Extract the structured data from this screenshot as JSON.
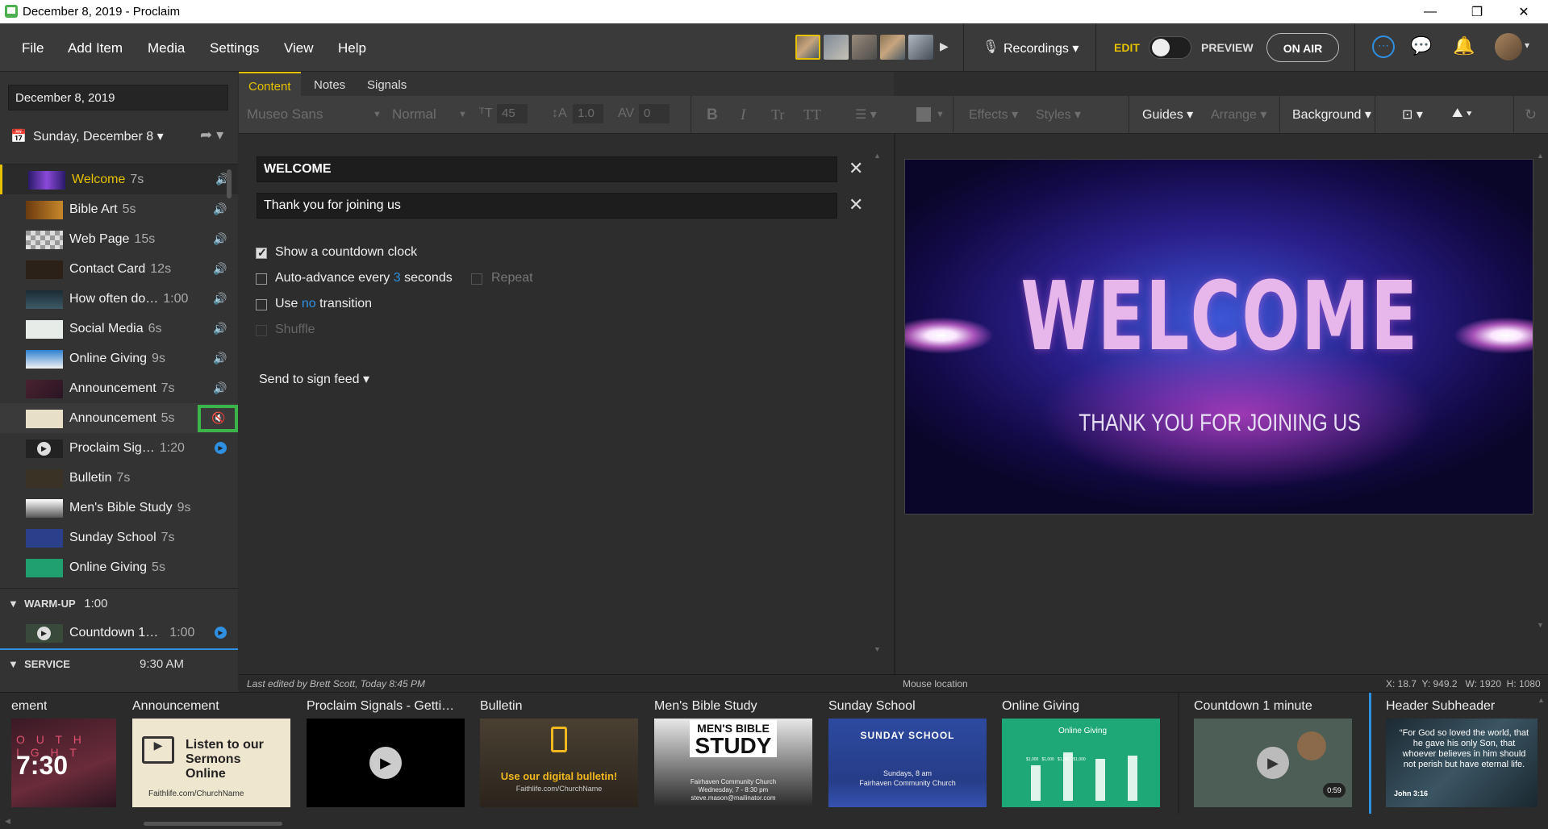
{
  "window": {
    "title": "December 8, 2019 - Proclaim",
    "controls": [
      "—",
      "❐",
      "✕"
    ]
  },
  "menu": [
    "File",
    "Add Item",
    "Media",
    "Settings",
    "View",
    "Help"
  ],
  "topbar": {
    "recordings": "Recordings",
    "edit": "EDIT",
    "preview": "PREVIEW",
    "onair": "ON AIR"
  },
  "sidebar": {
    "date": "December 8, 2019",
    "service_day": "Sunday, December 8",
    "items": [
      {
        "label": "Welcome",
        "dur": "7s"
      },
      {
        "label": "Bible Art",
        "dur": "5s"
      },
      {
        "label": "Web Page",
        "dur": "15s"
      },
      {
        "label": "Contact Card",
        "dur": "12s"
      },
      {
        "label": "How often do…",
        "dur": "1:00"
      },
      {
        "label": "Social Media",
        "dur": "6s"
      },
      {
        "label": "Online Giving",
        "dur": "9s"
      },
      {
        "label": "Announcement",
        "dur": "7s"
      },
      {
        "label": "Announcement",
        "dur": "5s"
      },
      {
        "label": "Proclaim Sig…",
        "dur": "1:20"
      },
      {
        "label": "Bulletin",
        "dur": "7s"
      },
      {
        "label": "Men's Bible Study",
        "dur": "9s"
      },
      {
        "label": "Sunday School",
        "dur": "7s"
      },
      {
        "label": "Online Giving",
        "dur": "5s"
      }
    ],
    "warmup": {
      "label": "WARM-UP",
      "dur": "1:00"
    },
    "warmup_item": {
      "label": "Countdown 1…",
      "dur": "1:00"
    },
    "service": {
      "label": "SERVICE",
      "time": "9:30 AM"
    }
  },
  "tabs": [
    "Content",
    "Notes",
    "Signals"
  ],
  "toolbar": {
    "font": "Museo Sans",
    "weight": "Normal",
    "size": "45",
    "line": "1.0",
    "spacing": "0",
    "bold": "B",
    "italic": "I",
    "tt1": "Tr",
    "tt2": "TT",
    "effects": "Effects",
    "styles": "Styles",
    "guides": "Guides",
    "arrange": "Arrange",
    "background": "Background"
  },
  "content": {
    "field1": "WELCOME",
    "field2": "Thank you for joining us",
    "countdown": "Show a countdown clock",
    "autoadv_pre": "Auto-advance every",
    "autoadv_num": "3",
    "autoadv_post": "seconds",
    "repeat": "Repeat",
    "trans_pre": "Use",
    "trans_val": "no",
    "trans_post": "transition",
    "shuffle": "Shuffle",
    "signfeed": "Send to sign feed"
  },
  "status": {
    "edited": "Last edited by Brett Scott, Today 8:45 PM",
    "mouse": "Mouse location",
    "coords": "X: 18.7  Y: 949.2   W: 1920  H: 1080"
  },
  "slide": {
    "title": "WELCOME",
    "subtitle": "THANK YOU FOR JOINING US"
  },
  "strip": [
    {
      "title": "ement",
      "text": "7:30",
      "subtext": "O U T H\nI G H T"
    },
    {
      "title": "Announcement",
      "text": "Listen to our Sermons Online",
      "subtext": "Faithlife.com/ChurchName"
    },
    {
      "title": "Proclaim Signals - Getti…"
    },
    {
      "title": "Bulletin",
      "text": "Use our digital bulletin!",
      "subtext": "Faithlife.com/ChurchName"
    },
    {
      "title": "Men's Bible Study",
      "text": "MEN'S BIBLE",
      "text2": "STUDY",
      "subtext": "Fairhaven Community Church\nWednesday, 7 - 8:30 pm\nsteve.mason@mailinator.com"
    },
    {
      "title": "Sunday School",
      "text": "SUNDAY SCHOOL",
      "subtext": "Sundays, 8 am\nFairhaven Community Church"
    },
    {
      "title": "Online Giving",
      "text": "Online Giving",
      "subtext": "$1,000   $1,000   $1,000   $1,000"
    },
    {
      "title": "Countdown 1 minute",
      "text": "0:59"
    },
    {
      "title": "Header Subheader",
      "text": "“For God so loved the world, that he gave his only Son, that whoever believes in him should not perish but have eternal life.",
      "subtext": "John 3:16"
    }
  ]
}
